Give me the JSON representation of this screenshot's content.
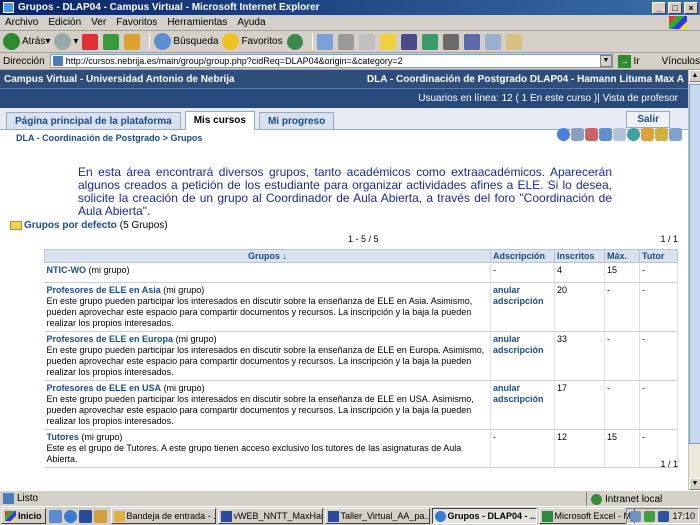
{
  "window": {
    "title": "Grupos - DLAP04 - Campus Virtual - Microsoft Internet Explorer"
  },
  "menu": [
    "Archivo",
    "Edición",
    "Ver",
    "Favoritos",
    "Herramientas",
    "Ayuda"
  ],
  "toolbar": {
    "back": "Atrás",
    "search": "Búsqueda",
    "favorites": "Favoritos"
  },
  "address": {
    "label": "Dirección",
    "url": "http://cursos.nebrija.es/main/group/group.php?cidReq=DLAP04&origin=&category=2",
    "go": "Ir",
    "links": "Vínculos"
  },
  "campus": {
    "left": "Campus Virtual - Universidad Antonio de Nebrija",
    "right": "DLA - Coordinación de Postgrado DLAP04 - Hamann Lituma Max A"
  },
  "users": "Usuarios en línea:  12  ( 1 En este curso )| Vista de profesor",
  "tabs": [
    "Página principal de la plataforma",
    "Mis cursos",
    "Mi progreso"
  ],
  "salir": "Salir",
  "breadcrumb": {
    "course": "DLA - Coordinación de Postgrado",
    "sep": " > ",
    "page": "Grupos"
  },
  "intro": "En esta área encontrará diversos grupos, tanto académicos como extraacadémicos. Aparecerán algunos creados a petición de los estudiante para organizar actividades afines a ELE. Si lo desea, solicite la creación de un grupo al Coordinador de Aula Abierta, a través del foro \"Coordinación de Aula Abierta\".",
  "groups_default": {
    "link": "Grupos por defecto",
    "count": "(5 Grupos)"
  },
  "pager": {
    "range": "1 - 5 / 5",
    "page": "1 / 1"
  },
  "table": {
    "headers": {
      "groups": "Grupos ↓",
      "adscripcion": "Adscripción",
      "inscritos": "Inscritos",
      "max": "Máx.",
      "tutor": "Tutor"
    },
    "rows": [
      {
        "name": "NTIC-WO",
        "tag": "(mi grupo)",
        "desc": "",
        "adscripcion": "-",
        "inscritos": "4",
        "max": "15",
        "tutor": "-"
      },
      {
        "name": "Profesores de ELE en Asia",
        "tag": "(mi grupo)",
        "desc": "En este grupo pueden participar los interesados en discutir sobre la enseñanza de ELE en Asia. Asimismo, pueden aprovechar este espacio para compartir documentos y recursos. La inscripción y la baja la pueden realizar los propios interesados.",
        "adscripcion": "anular adscripción",
        "inscritos": "20",
        "max": "-",
        "tutor": "-"
      },
      {
        "name": "Profesores de ELE en Europa",
        "tag": "(mi grupo)",
        "desc": "En este grupo pueden participar los interesados en discutir sobre la enseñanza de ELE en Europa. Asimismo, pueden aprovechar este espacio para compartir documentos y recursos. La inscripción y la baja la pueden realizar los propios interesados.",
        "adscripcion": "anular adscripción",
        "inscritos": "33",
        "max": "-",
        "tutor": "-"
      },
      {
        "name": "Profesores de ELE en USA",
        "tag": "(mi grupo)",
        "desc": "En este grupo pueden participar los interesados en discutir sobre la enseñanza de ELE en USA. Asimismo, pueden aprovechar este espacio para compartir documentos y recursos. La inscripción y la baja la pueden realizar los propios interesados.",
        "adscripcion": "anular adscripción",
        "inscritos": "17",
        "max": "-",
        "tutor": "-"
      },
      {
        "name": "Tutores",
        "tag": "(mi grupo)",
        "desc": "Este es el grupo de Tutores. A este grupo tienen acceso exclusivo los tutores de las asignaturas de Aula Abierta.",
        "adscripcion": "-",
        "inscritos": "12",
        "max": "15",
        "tutor": "-"
      }
    ]
  },
  "status": {
    "left": "Listo",
    "zone": "Intranet local"
  },
  "taskbar": {
    "start": "Inicio",
    "tasks": [
      "Bandeja de entrada - ...",
      "vWEB_NNTT_MaxHam...",
      "Taller_Virtual_AA_pa...",
      "Grupos - DLAP04 - ...",
      "Microsoft Excel - MAT..."
    ],
    "clock": "17:10"
  },
  "colors": {
    "campus_bar": "#2e4d7b",
    "link": "#1b4c87",
    "intro_text": "#1a2a8a"
  }
}
